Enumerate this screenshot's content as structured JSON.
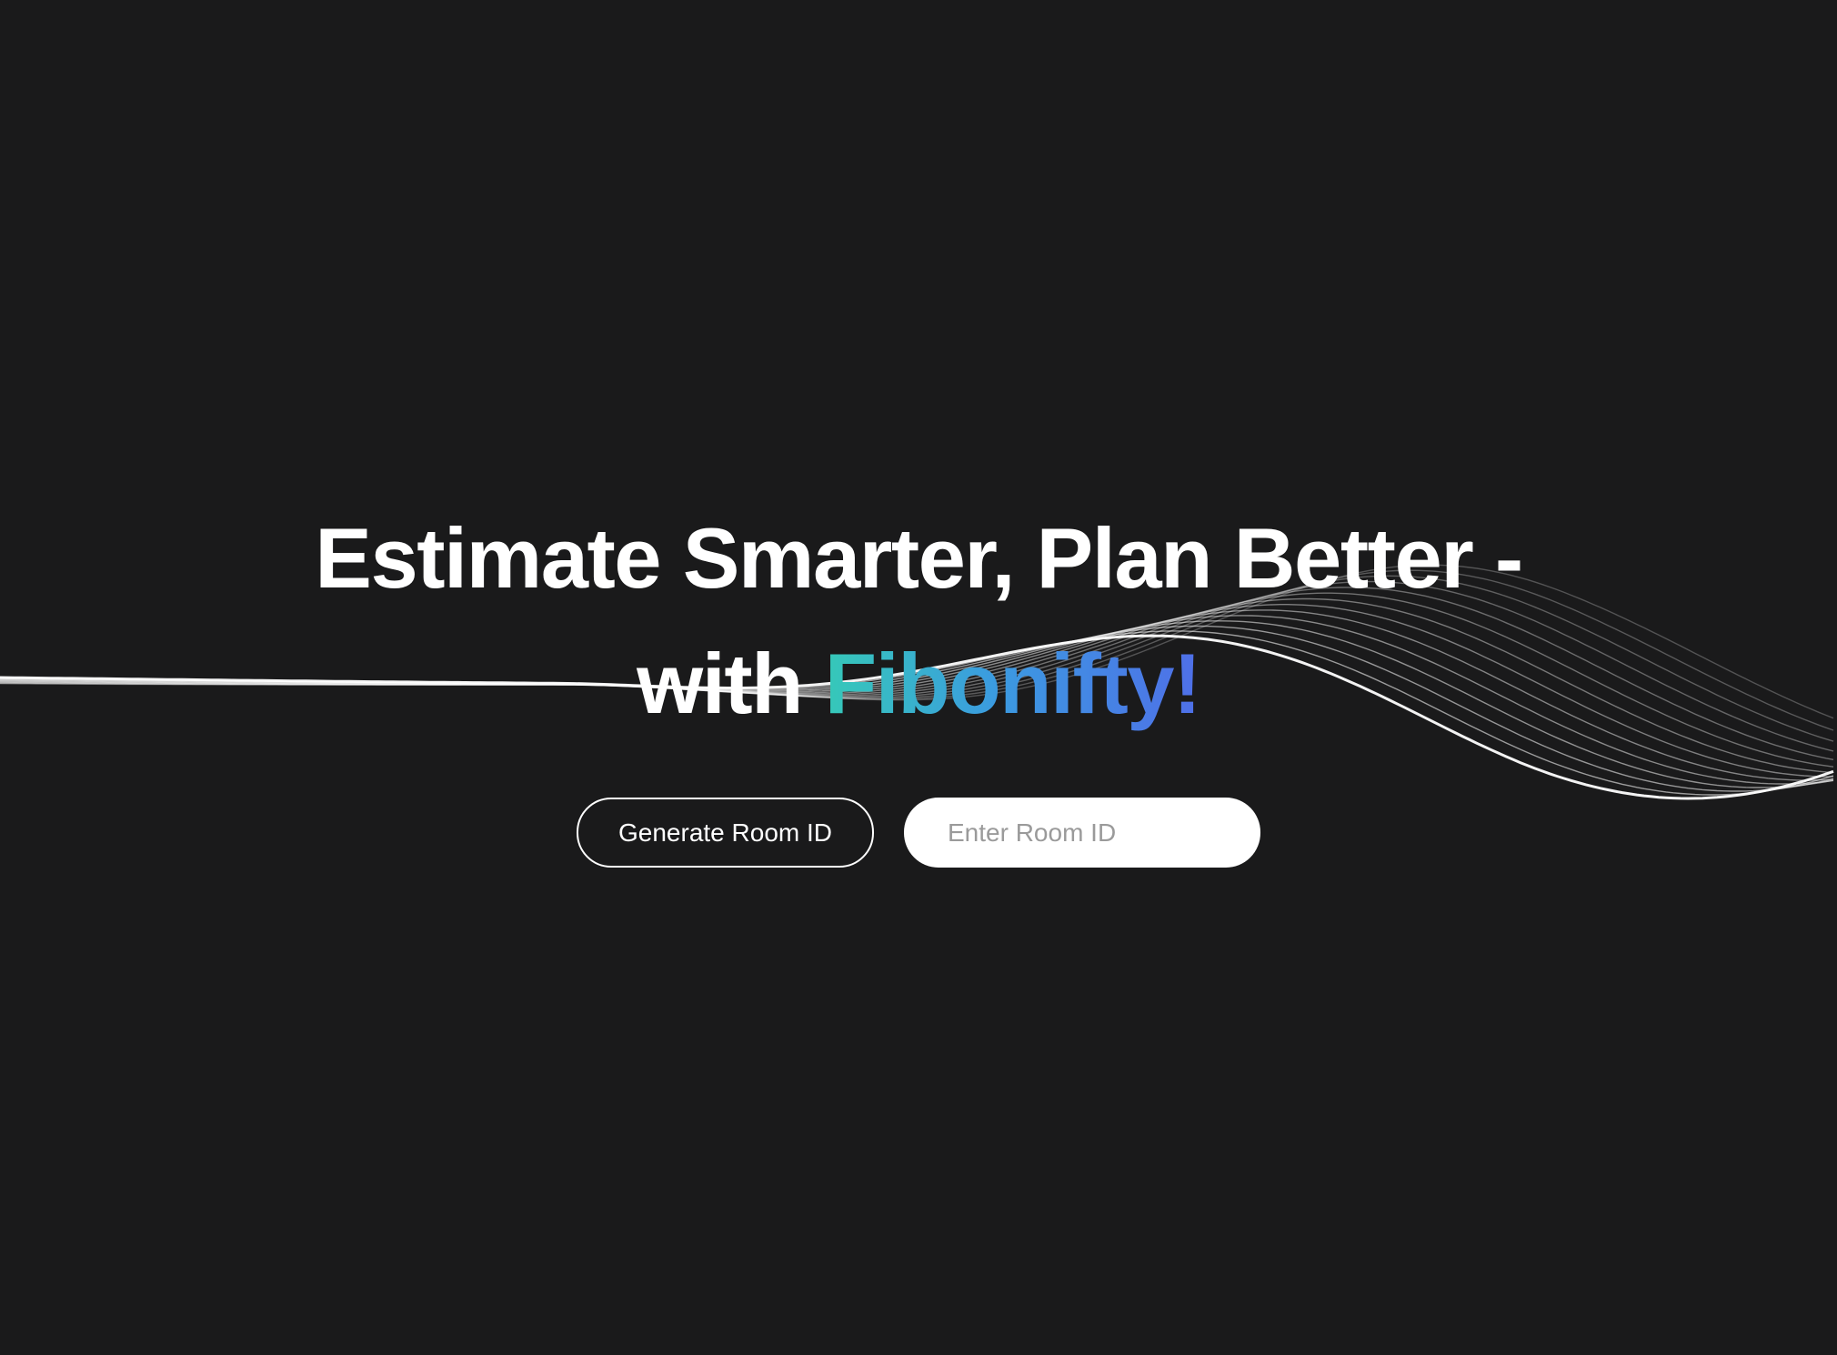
{
  "hero": {
    "headline_line1": "Estimate Smarter, Plan Better -",
    "headline_with": "with",
    "brand_name": "Fibonifty!"
  },
  "actions": {
    "generate_label": "Generate Room ID",
    "room_input_placeholder": "Enter Room ID",
    "room_input_value": ""
  },
  "colors": {
    "background": "#1a1a1b",
    "text": "#ffffff",
    "brand_gradient_start": "#36c9b8",
    "brand_gradient_end": "#4f6fe8"
  }
}
